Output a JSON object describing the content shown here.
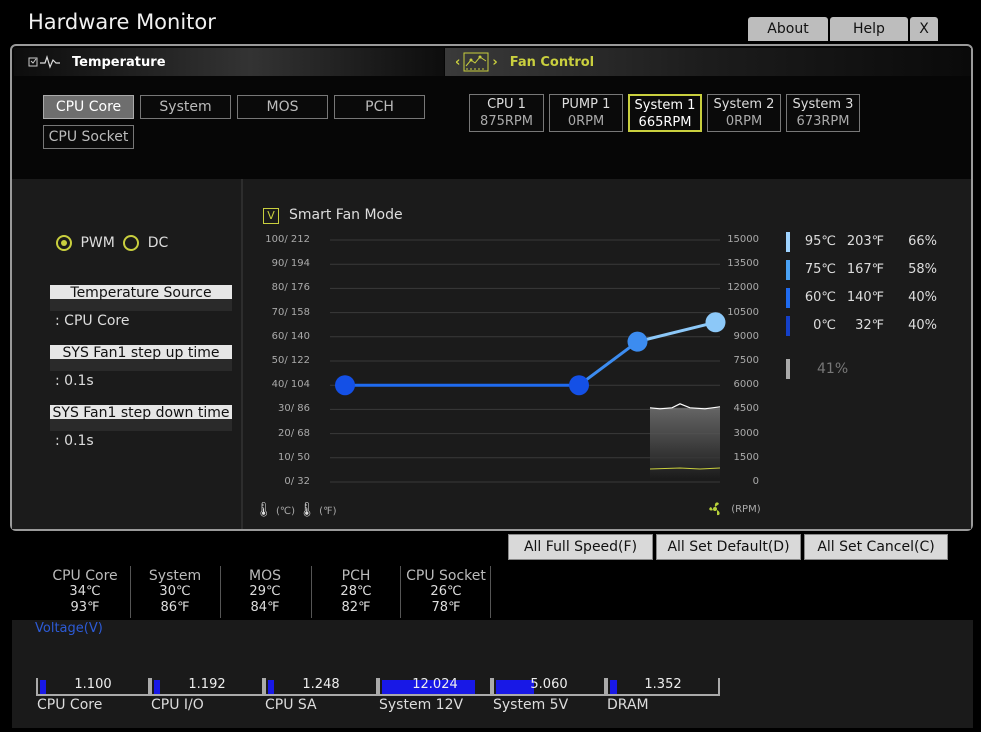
{
  "window": {
    "title": "Hardware Monitor"
  },
  "top_buttons": {
    "about": "About",
    "help": "Help",
    "close": "X"
  },
  "temperature": {
    "heading": "Temperature",
    "sources": [
      "CPU Core",
      "System",
      "MOS",
      "PCH",
      "CPU Socket"
    ],
    "active_source": "CPU Core"
  },
  "fan_control": {
    "heading": "Fan Control",
    "fans": [
      {
        "name": "CPU 1",
        "rpm": "875RPM"
      },
      {
        "name": "PUMP 1",
        "rpm": "0RPM"
      },
      {
        "name": "System 1",
        "rpm": "665RPM"
      },
      {
        "name": "System 2",
        "rpm": "0RPM"
      },
      {
        "name": "System 3",
        "rpm": "673RPM"
      }
    ],
    "active_fan": "System 1"
  },
  "settings": {
    "pwm_label": "PWM",
    "dc_label": "DC",
    "mode_selected": "PWM",
    "temp_source_label": "Temperature Source",
    "temp_source_value": ": CPU Core",
    "step_up_label": "SYS Fan1 step up time",
    "step_up_value": ": 0.1s",
    "step_down_label": "SYS Fan1 step down time",
    "step_down_value": ": 0.1s"
  },
  "chart": {
    "smart_fan_label": "Smart Fan Mode",
    "smart_fan_checked": "V",
    "left_unit_c": "(℃)",
    "left_unit_f": "(℉)",
    "right_unit": "(RPM)",
    "y_left_labels": [
      "100/ 212",
      "90/ 194",
      "80/ 176",
      "70/ 158",
      "60/ 140",
      "50/ 122",
      "40/ 104",
      "30/  86",
      "20/  68",
      "10/  50",
      "0/  32"
    ],
    "y_right_labels": [
      "15000",
      "13500",
      "12000",
      "10500",
      "9000",
      "7500",
      "6000",
      "4500",
      "3000",
      "1500",
      "0"
    ]
  },
  "chart_data": {
    "type": "line",
    "x_unit": "℃",
    "y_unit": "%",
    "xlim": [
      0,
      100
    ],
    "ylim": [
      0,
      100
    ],
    "curve_points": [
      {
        "temp_c": 0,
        "pwm": 40
      },
      {
        "temp_c": 60,
        "pwm": 40
      },
      {
        "temp_c": 75,
        "pwm": 58
      },
      {
        "temp_c": 95,
        "pwm": 66
      }
    ],
    "point_colors": [
      "#1450e6",
      "#1450e6",
      "#3c8cf0",
      "#8cc8f8"
    ],
    "rpm_history_level": 4600
  },
  "legend": [
    {
      "c": "95℃",
      "f": "203℉",
      "p": "66%",
      "color": "#9fd3ff"
    },
    {
      "c": "75℃",
      "f": "167℉",
      "p": "58%",
      "color": "#4aa2f5"
    },
    {
      "c": "60℃",
      "f": "140℉",
      "p": "40%",
      "color": "#1f6bf0"
    },
    {
      "c": "0℃",
      "f": "32℉",
      "p": "40%",
      "color": "#1440c8"
    }
  ],
  "current_pct": "41%",
  "actions": {
    "full_speed": "All Full Speed(F)",
    "set_default": "All Set Default(D)",
    "set_cancel": "All Set Cancel(C)"
  },
  "temps": [
    {
      "name": "CPU Core",
      "c": "34℃",
      "f": "93℉"
    },
    {
      "name": "System",
      "c": "30℃",
      "f": "86℉"
    },
    {
      "name": "MOS",
      "c": "29℃",
      "f": "84℉"
    },
    {
      "name": "PCH",
      "c": "28℃",
      "f": "82℉"
    },
    {
      "name": "CPU Socket",
      "c": "26℃",
      "f": "78℉"
    }
  ],
  "voltage": {
    "heading": "Voltage(V)",
    "items": [
      {
        "name": "CPU Core",
        "value": "1.100",
        "fill": 0.06
      },
      {
        "name": "CPU I/O",
        "value": "1.192",
        "fill": 0.06
      },
      {
        "name": "CPU SA",
        "value": "1.248",
        "fill": 0.06
      },
      {
        "name": "System 12V",
        "value": "12.024",
        "fill": 0.88
      },
      {
        "name": "System 5V",
        "value": "5.060",
        "fill": 0.36
      },
      {
        "name": "DRAM",
        "value": "1.352",
        "fill": 0.07
      }
    ]
  }
}
